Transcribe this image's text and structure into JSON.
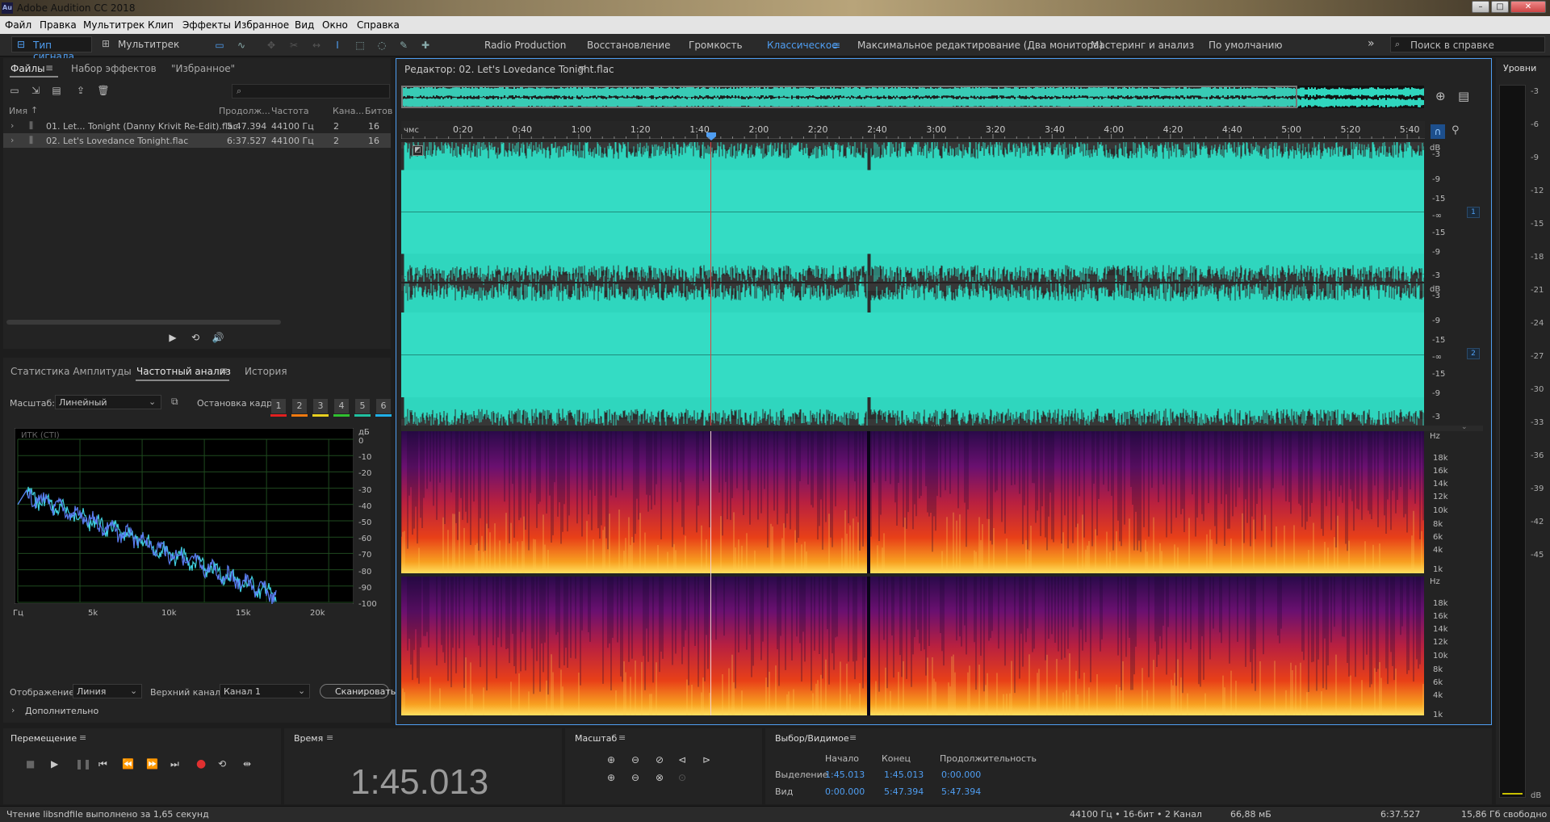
{
  "app": {
    "title": "Adobe Audition CC 2018",
    "logo": "Au"
  },
  "window_controls": {
    "minimize": "–",
    "maximize": "□",
    "close": "✕"
  },
  "menu": [
    "Файл",
    "Правка",
    "Мультитрек",
    "Клип",
    "Эффекты",
    "Избранное",
    "Вид",
    "Окно",
    "Справка"
  ],
  "toolbar": {
    "waveform_view": "Тип сигнала",
    "multitrack_view": "Мультитрек",
    "workspaces": [
      "Radio Production",
      "Восстановление",
      "Громкость",
      "Классическое",
      "Максимальное редактирование (Два монитора)",
      "Мастеринг и анализ",
      "По умолчанию"
    ],
    "active_workspace": "Классическое",
    "more": "»",
    "search_placeholder": "Поиск в справке"
  },
  "files_panel": {
    "tabs": [
      "Файлы",
      "Набор эффектов",
      "\"Избранное\""
    ],
    "columns": [
      "Имя",
      "Продолж...",
      "Частота",
      "Кана...",
      "Битов"
    ],
    "rows": [
      {
        "name": "01. Let... Tonight (Danny Krivit Re-Edit).flac",
        "duration": "5:47.394",
        "rate": "44100 Гц",
        "channels": "2",
        "bits": "16"
      },
      {
        "name": "02. Let's Lovedance Tonight.flac",
        "duration": "6:37.527",
        "rate": "44100 Гц",
        "channels": "2",
        "bits": "16"
      }
    ],
    "search_icon": "⌕"
  },
  "analysis_panel": {
    "tabs": [
      "Статистика Амплитуды",
      "Частотный анализ",
      "История"
    ],
    "scale_label": "Масштаб:",
    "scale_value": "Линейный",
    "freeze_label": "Остановка кадра:",
    "freeze_buttons": [
      "1",
      "2",
      "3",
      "4",
      "5",
      "6"
    ],
    "freeze_colors": [
      "#e02020",
      "#f07a10",
      "#e8d020",
      "#30c030",
      "#20c0a0",
      "#20b0e8"
    ],
    "graph_label": "ИТК (CTI)",
    "db_unit": "дБ",
    "db_ticks": [
      "0",
      "-10",
      "-20",
      "-30",
      "-40",
      "-50",
      "-60",
      "-70",
      "-80",
      "-90",
      "-100"
    ],
    "hz_ticks": [
      "Гц",
      "5k",
      "10k",
      "15k",
      "20k"
    ],
    "display_label": "Отображение:",
    "display_value": "Линия",
    "channel_label": "Верхний канал:",
    "channel_value": "Канал 1",
    "scan_button": "Сканировать",
    "advanced": "Дополнительно"
  },
  "editor": {
    "title": "Редактор: 02. Let's Lovedance Tonight.flac",
    "ruler_unit": "чмс",
    "ruler_labels": [
      "0:20",
      "0:40",
      "1:00",
      "1:20",
      "1:40",
      "2:00",
      "2:20",
      "2:40",
      "3:00",
      "3:20",
      "3:40",
      "4:00",
      "4:20",
      "4:40",
      "5:00",
      "5:20",
      "5:40"
    ],
    "db_unit": "dB",
    "db_labels": [
      "-3",
      "-9",
      "-15",
      "-∞",
      "-15",
      "-9",
      "-3"
    ],
    "channel_badges": [
      "1",
      "2"
    ],
    "hz_unit": "Hz",
    "hz_labels": [
      "18k",
      "16k",
      "14k",
      "12k",
      "10k",
      "8k",
      "6k",
      "4k",
      "1k"
    ],
    "colors": {
      "waveform": "#2fd6be",
      "waveform_bg": "#3a3a3a",
      "playhead": "#e04040",
      "accent": "#4f9ef2"
    }
  },
  "levels": {
    "title": "Уровни",
    "ticks": [
      "-3",
      "-6",
      "-9",
      "-12",
      "-15",
      "-18",
      "-21",
      "-24",
      "-27",
      "-30",
      "-33",
      "-36",
      "-39",
      "-42",
      "-45"
    ],
    "unit": "dB"
  },
  "transport": {
    "title": "Перемещение"
  },
  "time": {
    "title": "Время",
    "value": "1:45.013"
  },
  "zoom": {
    "title": "Масштаб"
  },
  "selection": {
    "title": "Выбор/Видимое",
    "headers": [
      "Начало",
      "Конец",
      "Продолжительность"
    ],
    "rows": [
      {
        "label": "Выделение",
        "start": "1:45.013",
        "end": "1:45.013",
        "duration": "0:00.000"
      },
      {
        "label": "Вид",
        "start": "0:00.000",
        "end": "5:47.394",
        "duration": "5:47.394"
      }
    ]
  },
  "status": {
    "message": "Чтение libsndfile выполнено за 1,65 секунд",
    "format": "44100 Гц • 16-бит • 2 Канал",
    "size": "66,88 мБ",
    "duration": "6:37.527",
    "free": "15,86 Гб свободно"
  }
}
